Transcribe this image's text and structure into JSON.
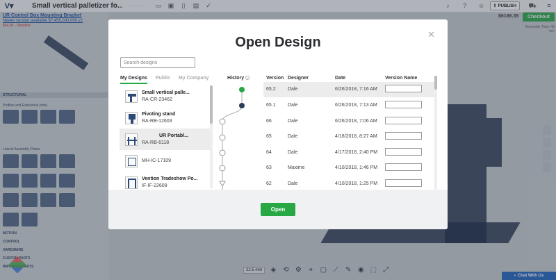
{
  "app": {
    "project_title": "Small vertical palletizer fo...",
    "publish_label": "PUBLISH",
    "left_title": "UR Control Box Mounting Bracket",
    "left_link": "Newer version available $7,456,000.000 v2",
    "left_price_note": "$54.00 - Obsolete",
    "price": "$6186.35",
    "checkout_label": "Checkout",
    "assembly_info": "Assembly Time: 45 min",
    "sections": [
      "STRUCTURAL",
      "MOTION",
      "CONTROL",
      "HARDWARE",
      "CUSTOM PARTS",
      "IMPORTED PARTS"
    ],
    "sub_labels": [
      "Profiles and Extrusions (mm)",
      "Lateral Assembly Plates"
    ],
    "zoom": "22.5 mm",
    "chat_label": "Chat With Us"
  },
  "modal": {
    "title": "Open Design",
    "search_placeholder": "Search designs",
    "tabs": [
      "My Designs",
      "Public",
      "My Company"
    ],
    "designs": [
      {
        "name": "Small vertical palle...",
        "id": "RA-CR-23462"
      },
      {
        "name": "Pivoting stand",
        "id": "RA-RB-12603"
      },
      {
        "name": "UR Portabl...",
        "id": "RA-RB-6118"
      },
      {
        "name": "",
        "id": "MH-IC-17109"
      },
      {
        "name": "Vention Tradeshow Po...",
        "id": "IF-IF-22609"
      }
    ],
    "history_label": "History",
    "columns": {
      "version": "Version",
      "designer": "Designer",
      "date": "Date",
      "version_name": "Version Name"
    },
    "versions": [
      {
        "version": "65.2",
        "designer": "Dale",
        "date": "6/26/2018, 7:16 AM"
      },
      {
        "version": "65.1",
        "designer": "Dale",
        "date": "6/26/2018, 7:13 AM"
      },
      {
        "version": "66",
        "designer": "Dale",
        "date": "6/26/2018, 7:06 AM"
      },
      {
        "version": "65",
        "designer": "Dale",
        "date": "4/18/2018, 8:27 AM"
      },
      {
        "version": "64",
        "designer": "Dale",
        "date": "4/17/2018, 2:40 PM"
      },
      {
        "version": "63",
        "designer": "Maxime",
        "date": "4/10/2018, 1:46 PM"
      },
      {
        "version": "62",
        "designer": "Dale",
        "date": "4/10/2018, 1:25 PM"
      }
    ],
    "open_label": "Open",
    "colors": {
      "accent": "#27a844",
      "current_dot": "#27a844",
      "branch_dot": "#2b3d5c"
    }
  }
}
